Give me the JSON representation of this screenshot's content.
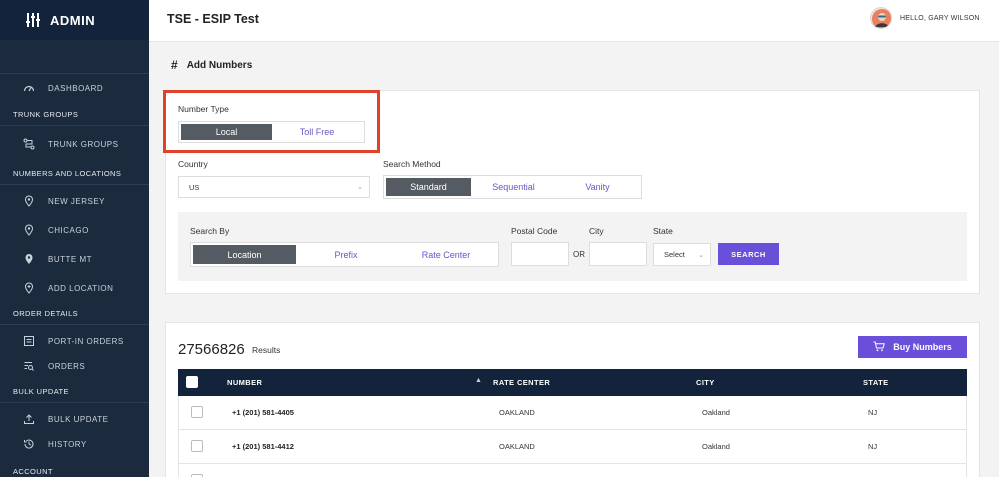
{
  "brand": {
    "title": "ADMIN"
  },
  "sidebar": {
    "dashboard": "DASHBOARD",
    "sections": {
      "trunk_groups": "TRUNK GROUPS",
      "numbers_and_locations": "NUMBERS AND LOCATIONS",
      "order_details": "ORDER DETAILS",
      "bulk_update": "BULK UPDATE",
      "account": "ACCOUNT"
    },
    "items": {
      "trunk_groups": "TRUNK GROUPS",
      "new_jersey": "NEW JERSEY",
      "chicago": "CHICAGO",
      "butte_mt": "BUTTE MT",
      "add_location": "ADD LOCATION",
      "port_in_orders": "PORT-IN ORDERS",
      "orders": "ORDERS",
      "bulk_update": "BULK UPDATE",
      "history": "HISTORY"
    }
  },
  "header": {
    "title": "TSE - ESIP Test",
    "greeting": "HELLO, GARY WILSON"
  },
  "page": {
    "title": "Add Numbers"
  },
  "search": {
    "number_type_label": "Number Type",
    "number_type_options": [
      "Local",
      "Toll Free"
    ],
    "number_type_selected": "Local",
    "country_label": "Country",
    "country_value": "US",
    "search_method_label": "Search Method",
    "search_method_options": [
      "Standard",
      "Sequential",
      "Vanity"
    ],
    "search_method_selected": "Standard",
    "search_by_label": "Search By",
    "search_by_options": [
      "Location",
      "Prefix",
      "Rate Center"
    ],
    "search_by_selected": "Location",
    "postal_code_label": "Postal Code",
    "or_label": "OR",
    "city_label": "City",
    "state_label": "State",
    "state_value": "Select",
    "search_button": "SEARCH"
  },
  "results": {
    "count": "27566826",
    "label": "Results",
    "buy_button": "Buy Numbers",
    "columns": [
      "NUMBER",
      "RATE CENTER",
      "CITY",
      "STATE"
    ],
    "rows": [
      {
        "number": "+1 (201) 581-4405",
        "rate_center": "OAKLAND",
        "city": "Oakland",
        "state": "NJ"
      },
      {
        "number": "+1 (201) 581-4412",
        "rate_center": "OAKLAND",
        "city": "Oakland",
        "state": "NJ"
      }
    ]
  },
  "colors": {
    "sidebar_bg": "#1c2a3d",
    "accent": "#6a4fdb",
    "highlight": "#e0412b",
    "table_header": "#12233b"
  }
}
